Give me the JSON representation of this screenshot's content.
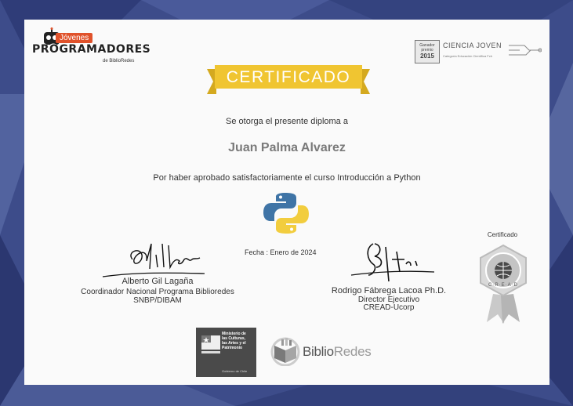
{
  "logo_left": {
    "tag": "Jóvenes",
    "title": "PROGRAMADORES",
    "subtitle": "de BiblioRedes"
  },
  "logo_right": {
    "box_text_1": "Ganador",
    "box_text_2": "premio",
    "box_year": "2015",
    "title": "CIENCIA JOVEN",
    "subtitle": "Categoría Educación Científica Fch"
  },
  "banner": {
    "title": "CERTIFICADO"
  },
  "body": {
    "grant_line": "Se otorga el presente diploma a",
    "recipient": "Juan Palma Alvarez",
    "reason": "Por haber aprobado satisfactoriamente el curso Introducción a Python"
  },
  "date_text": "Fecha : Enero de 2024",
  "signer_left": {
    "name": "Alberto Gil Lagaña",
    "role_1": "Coordinador Nacional Programa Biblioredes",
    "role_2": "SNBP/DIBAM"
  },
  "signer_right": {
    "name": "Rodrigo Fábrega Lacoa Ph.D.",
    "role_1": "Director Ejecutivo",
    "role_2": "CREAD-Ucorp"
  },
  "seal": {
    "label": "Certificado",
    "text": "C·R·E·A·D"
  },
  "ministry": {
    "line_1": "Ministerio de",
    "line_2": "las Culturas,",
    "line_3": "las Artes y el",
    "line_4": "Patrimonio",
    "footer": "Gobierno de Chile"
  },
  "biblio": {
    "part1": "Biblio",
    "part2": "Redes"
  },
  "colors": {
    "banner": "#f0c531",
    "background": "#3b4a86",
    "card": "#fafafa"
  }
}
